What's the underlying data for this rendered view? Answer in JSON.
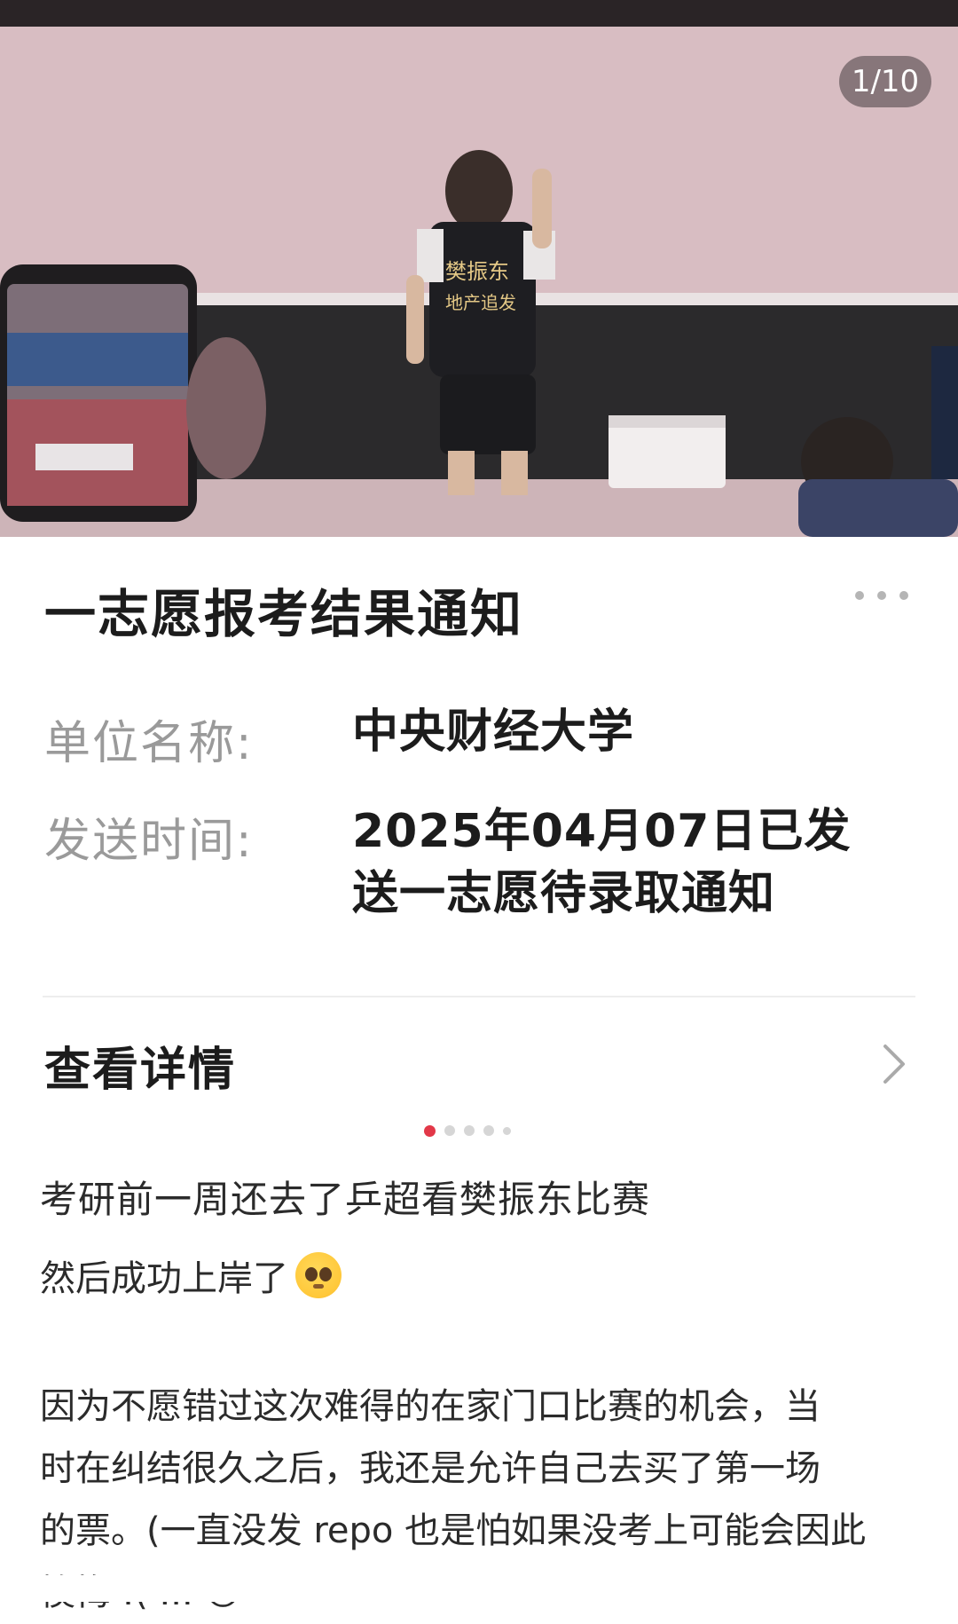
{
  "photo": {
    "counter": "1/10",
    "jersey_text": [
      "樊振东",
      "地产追发"
    ]
  },
  "card": {
    "title": "一志愿报考结果通知",
    "unit_label": "单位名称:",
    "unit_value": "中央财经大学",
    "time_label": "发送时间:",
    "time_value_line1": "2025年04月07日已发",
    "time_value_line2": "送一志愿待录取通知",
    "detail_label": "查看详情"
  },
  "carousel": {
    "total_dots": 5,
    "active_index": 0
  },
  "post": {
    "title": "考研前一周还去了乒超看樊振东比赛",
    "line2": "然后成功上岸了",
    "emoji": "pleading-face",
    "body": [
      "因为不愿错过这次难得的在家门口比赛的机会，当",
      "时在纠结很久之后，我还是允许自己去买了第一场",
      "的票。(一直没发 repo 也是怕如果没考上可能会因此",
      "懊悔 :( ... 😊"
    ]
  },
  "colors": {
    "accent": "#e23848",
    "label_gray": "#9a9a9a",
    "text_dark": "#1c1c1c"
  }
}
